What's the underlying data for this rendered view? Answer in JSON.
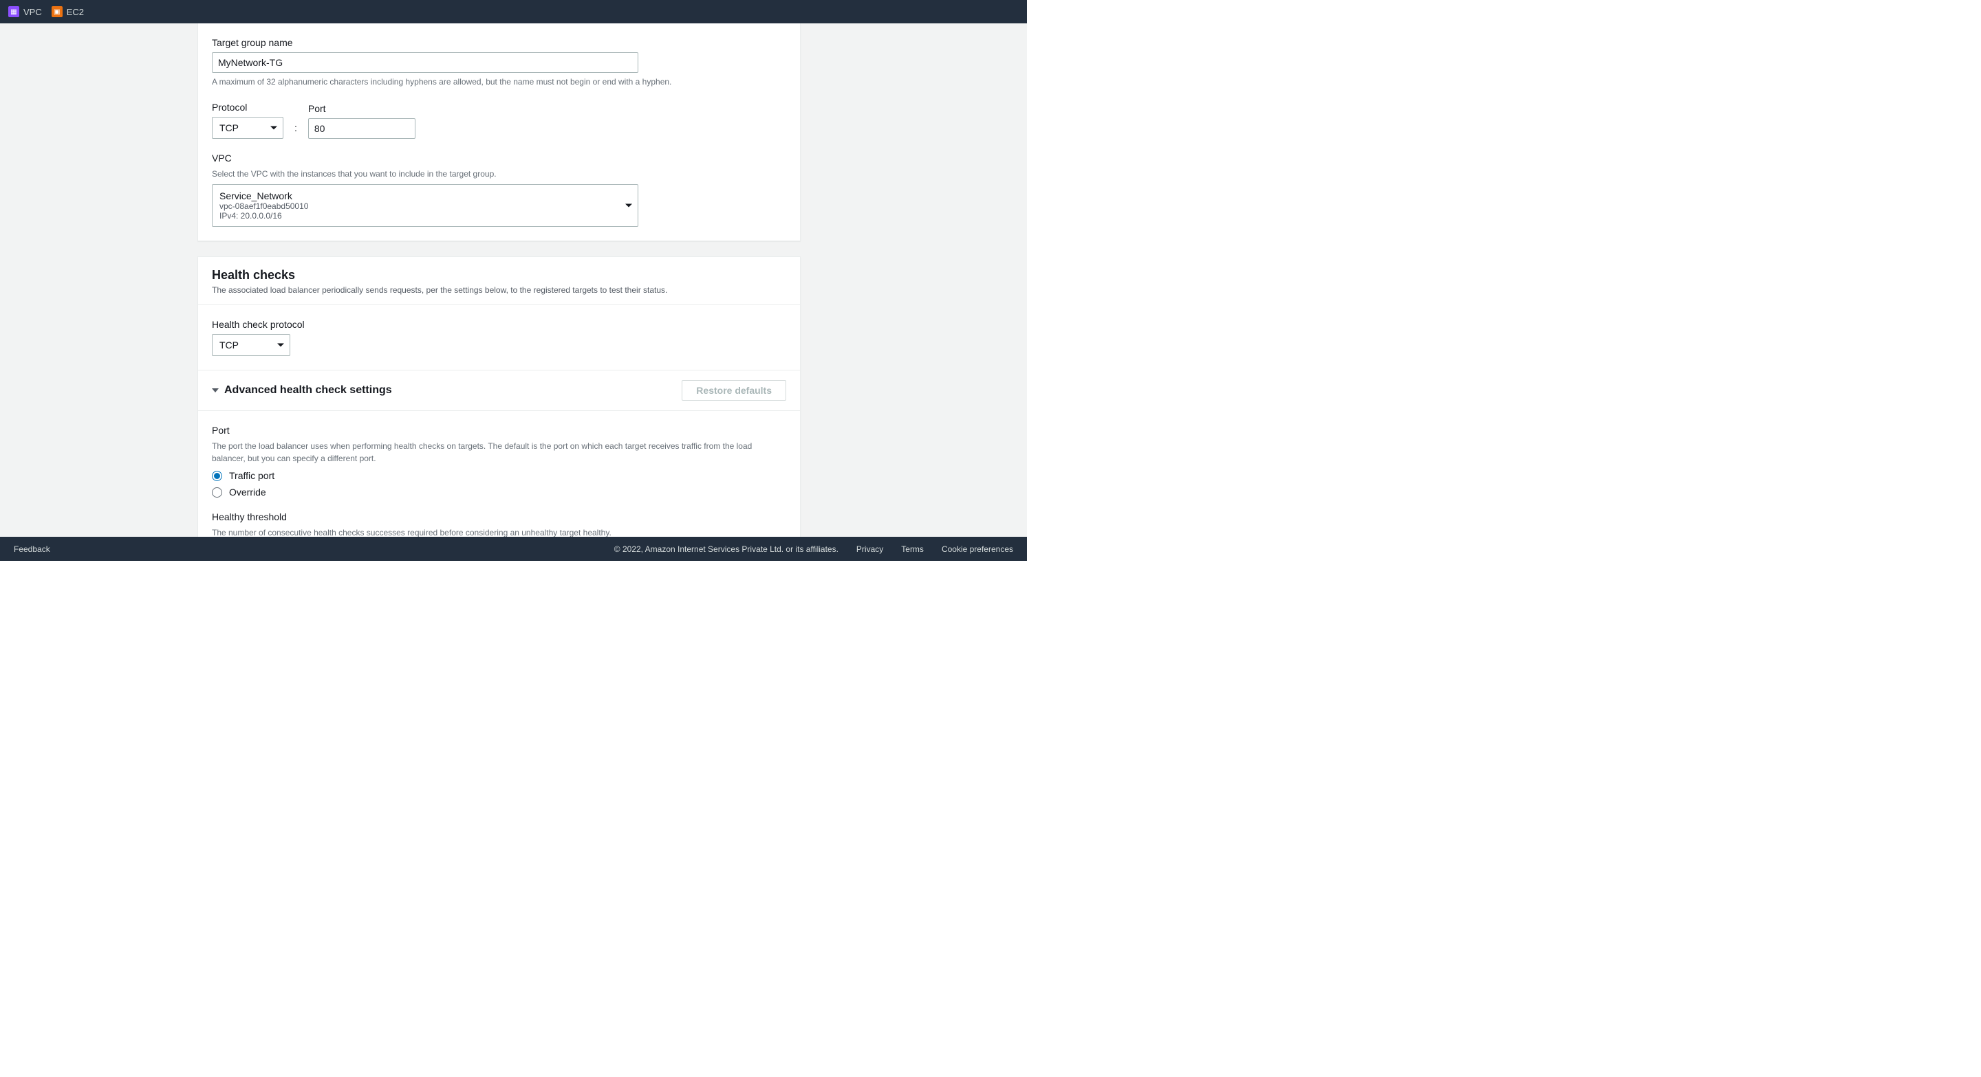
{
  "nav": {
    "vpc_label": "VPC",
    "ec2_label": "EC2"
  },
  "target_group": {
    "name_label": "Target group name",
    "name_value": "MyNetwork-TG",
    "name_hint": "A maximum of 32 alphanumeric characters including hyphens are allowed, but the name must not begin or end with a hyphen.",
    "protocol_label": "Protocol",
    "protocol_value": "TCP",
    "port_label": "Port",
    "port_value": "80",
    "vpc_label": "VPC",
    "vpc_hint": "Select the VPC with the instances that you want to include in the target group.",
    "vpc_selected": {
      "name": "Service_Network",
      "id": "vpc-08aef1f0eabd50010",
      "cidr": "IPv4: 20.0.0.0/16"
    }
  },
  "health_checks": {
    "title": "Health checks",
    "subtitle": "The associated load balancer periodically sends requests, per the settings below, to the registered targets to test their status.",
    "protocol_label": "Health check protocol",
    "protocol_value": "TCP",
    "advanced_title": "Advanced health check settings",
    "restore_defaults_label": "Restore defaults",
    "port": {
      "label": "Port",
      "hint": "The port the load balancer uses when performing health checks on targets. The default is the port on which each target receives traffic from the load balancer, but you can specify a different port.",
      "option_traffic": "Traffic port",
      "option_override": "Override",
      "selected": "traffic"
    },
    "healthy_threshold": {
      "label": "Healthy threshold",
      "hint": "The number of consecutive health checks successes required before considering an unhealthy target healthy."
    }
  },
  "footer": {
    "feedback": "Feedback",
    "copyright": "© 2022, Amazon Internet Services Private Ltd. or its affiliates.",
    "privacy": "Privacy",
    "terms": "Terms",
    "cookie": "Cookie preferences"
  }
}
